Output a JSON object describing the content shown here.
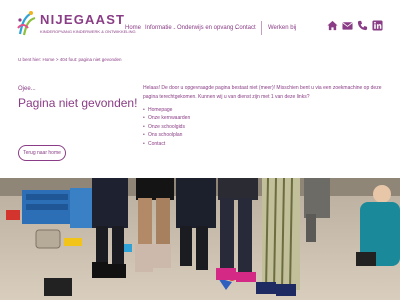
{
  "header": {
    "logo": {
      "name": "NIJEGAAST",
      "tagline": "KINDEROPVANG KINDERWERK & ONTWIKKELING"
    },
    "nav": [
      {
        "label": "Home"
      },
      {
        "label": "Informatie",
        "dropdown": true
      },
      {
        "label": "Onderwijs en opvang",
        "dropdown": true
      },
      {
        "label": "Contact"
      },
      {
        "label": "Werken bij"
      }
    ],
    "icons": [
      "home-icon",
      "mail-icon",
      "phone-icon",
      "linkedin-icon"
    ]
  },
  "breadcrumb": {
    "prefix": "U bent hier:",
    "home": "Home",
    "separator": ">",
    "current": "404 fout: pagina niet gevonden"
  },
  "error": {
    "oops": "Ojee...",
    "title": "Pagina niet gevonden!",
    "button": "Terug naar home"
  },
  "content": {
    "intro": "Helaas! De door u opgevraagde pagina bestaat niet (meer)! Misschien bent u via een zoekmachine op deze pagina terechtgekomen. Kunnen wij u van dienst zijn met 1 van deze links?",
    "links": [
      "Homepage",
      "Onze kernwaarden",
      "Onze schoolgids",
      "Ons schoolplan",
      "Contact"
    ]
  },
  "colors": {
    "brand": "#8a3d86",
    "accent_green": "#8bbf3f",
    "accent_blue": "#2fa3d8"
  }
}
